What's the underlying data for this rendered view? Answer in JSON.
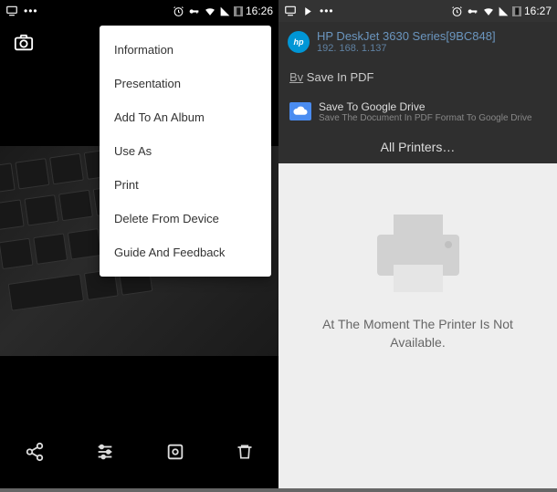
{
  "left": {
    "status": {
      "time": "16:26"
    },
    "menu": {
      "items": [
        "Information",
        "Presentation",
        "Add To An Album",
        "Use As",
        "Print",
        "Delete From Device",
        "Guide And Feedback"
      ]
    }
  },
  "right": {
    "status": {
      "time": "16:27"
    },
    "printer": {
      "hp_label": "hp",
      "name": "HP DeskJet 3630 Series[9BC848]",
      "ip": "192. 168. 1.137"
    },
    "save_pdf": {
      "prefix": "Bv",
      "label": "Save In PDF"
    },
    "drive": {
      "title": "Save To Google Drive",
      "subtitle": "Save The Document In PDF Format To Google Drive"
    },
    "all_printers": "All Printers…",
    "empty_text": "At The Moment The Printer Is Not Available."
  }
}
